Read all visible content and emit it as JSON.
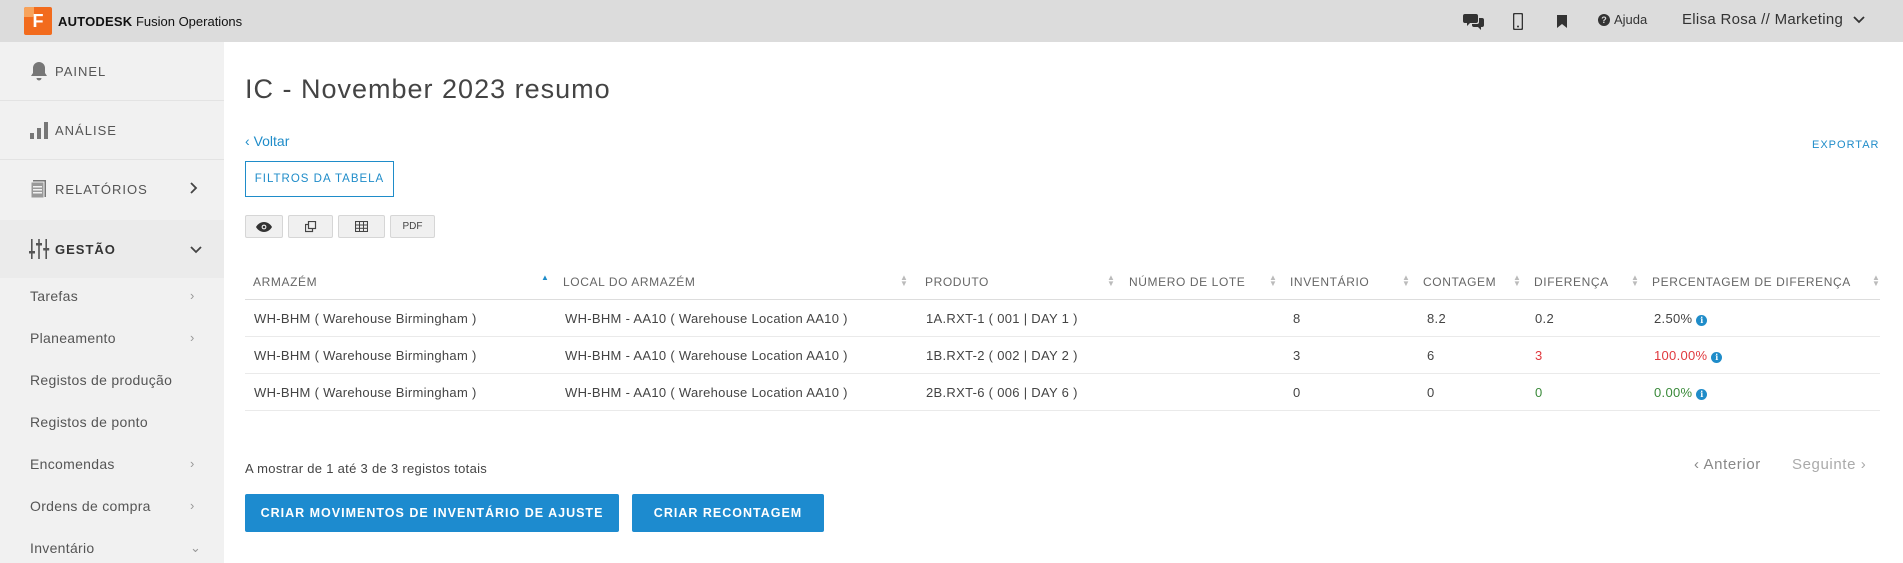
{
  "topbar": {
    "brand_badge": "F",
    "brand_bold": "AUTODESK",
    "brand_rest": "Fusion Operations",
    "icons": [
      "chat-icon",
      "mobile-icon",
      "bookmark-icon"
    ],
    "help_label": "Ajuda",
    "user_label": "Elisa Rosa // Marketing"
  },
  "sidebar": {
    "main": [
      {
        "label": "PAINEL",
        "icon": "bell-icon"
      },
      {
        "label": "ANÁLISE",
        "icon": "bar-chart-icon"
      },
      {
        "label": "RELATÓRIOS",
        "icon": "report-icon"
      },
      {
        "label": "GESTÃO",
        "icon": "sliders-icon"
      }
    ],
    "sub": [
      "Tarefas",
      "Planeamento",
      "Registos de produção",
      "Registos de ponto",
      "Encomendas",
      "Ordens de compra",
      "Inventário"
    ]
  },
  "page": {
    "title": "IC - November 2023 resumo",
    "back_label": "Voltar",
    "export_label": "EXPORTAR",
    "filters_label": "FILTROS DA TABELA",
    "pdf_label": "PDF"
  },
  "table": {
    "headers": [
      "ARMAZÉM",
      "LOCAL DO ARMAZÉM",
      "PRODUTO",
      "NÚMERO DE LOTE",
      "INVENTÁRIO",
      "CONTAGEM",
      "DIFERENÇA",
      "PERCENTAGEM DE DIFERENÇA"
    ],
    "rows": [
      [
        "WH-BHM ( Warehouse Birmingham )",
        "WH-BHM - AA10 ( Warehouse Location AA10 )",
        "1A.RXT-1 ( 001 | DAY 1 )",
        "",
        "8",
        "8.2",
        "0.2",
        "2.50%"
      ],
      [
        "WH-BHM ( Warehouse Birmingham )",
        "WH-BHM - AA10 ( Warehouse Location AA10 )",
        "1B.RXT-2 ( 002 | DAY 2 )",
        "",
        "3",
        "6",
        "3",
        "100.00%"
      ],
      [
        "WH-BHM ( Warehouse Birmingham )",
        "WH-BHM - AA10 ( Warehouse Location AA10 )",
        "2B.RXT-6 ( 006 | DAY 6 )",
        "",
        "0",
        "0",
        "0",
        "0.00%"
      ]
    ],
    "status_colors": {
      "positive": "#e0393e",
      "zero": "#3a8a3a",
      "neutral": "#444444"
    }
  },
  "pagination": {
    "summary": "A mostrar de 1 até 3 de 3 registos totais",
    "prev_label": "Anterior",
    "next_label": "Seguinte"
  },
  "actions": {
    "adjust_label": "CRIAR MOVIMENTOS DE INVENTÁRIO DE AJUSTE",
    "recount_label": "CRIAR RECONTAGEM"
  },
  "colors": {
    "accent": "#1f8cc9",
    "brand": "#f26b1d",
    "topbar": "#dcdcdc",
    "sidebar": "#f1f1f1"
  }
}
